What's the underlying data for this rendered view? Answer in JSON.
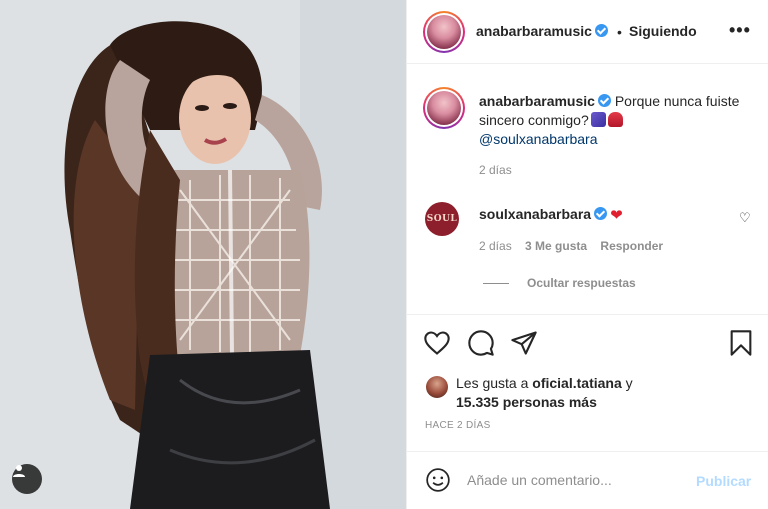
{
  "post": {
    "username": "anabarbaramusic",
    "verified": true,
    "follow_separator": "•",
    "follow_status": "Siguiendo",
    "more_icon": "more-horizontal-icon"
  },
  "caption": {
    "username": "anabarbaramusic",
    "text": "Porque nunca fuiste sincero conmigo?",
    "mention": "@soulxanabarbara",
    "time": "2 días"
  },
  "reply": {
    "avatar_text": "SOUL",
    "username": "soulxanabarbara",
    "time": "2 días",
    "likes": "3 Me gusta",
    "reply_label": "Responder",
    "hide_replies": "Ocultar respuestas"
  },
  "likes": {
    "prefix": "Les gusta a ",
    "user": "oficial.tatiana",
    "and": " y",
    "others": "15.335 personas más"
  },
  "date": "HACE 2 DÍAS",
  "comment_box": {
    "placeholder": "Añade un comentario...",
    "publish_label": "Publicar"
  },
  "colors": {
    "accent_blue": "#3897f0",
    "publish_disabled": "#b3dbff",
    "heart_red": "#e0202f",
    "muted": "#8e8e8e"
  }
}
